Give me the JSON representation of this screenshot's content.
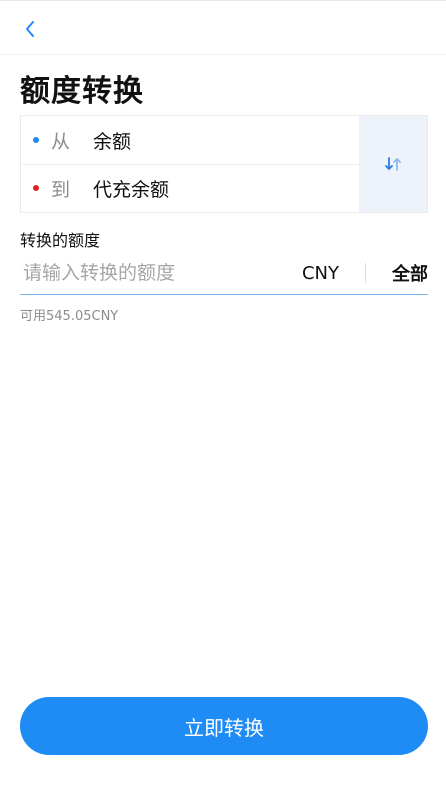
{
  "page_title": "额度转换",
  "icons": {
    "back": "chevron-left-icon",
    "swap": "swap-vertical-icon"
  },
  "colors": {
    "accent": "#1f8cf5",
    "from_dot": "#1f8cf5",
    "to_dot": "#e02020"
  },
  "transfer": {
    "from_label": "从",
    "from_value": "余额",
    "to_label": "到",
    "to_value": "代充余额"
  },
  "amount": {
    "label": "转换的额度",
    "placeholder": "请输入转换的额度",
    "value": "",
    "currency": "CNY",
    "all_label": "全部",
    "available": "可用545.05CNY"
  },
  "submit_label": "立即转换"
}
